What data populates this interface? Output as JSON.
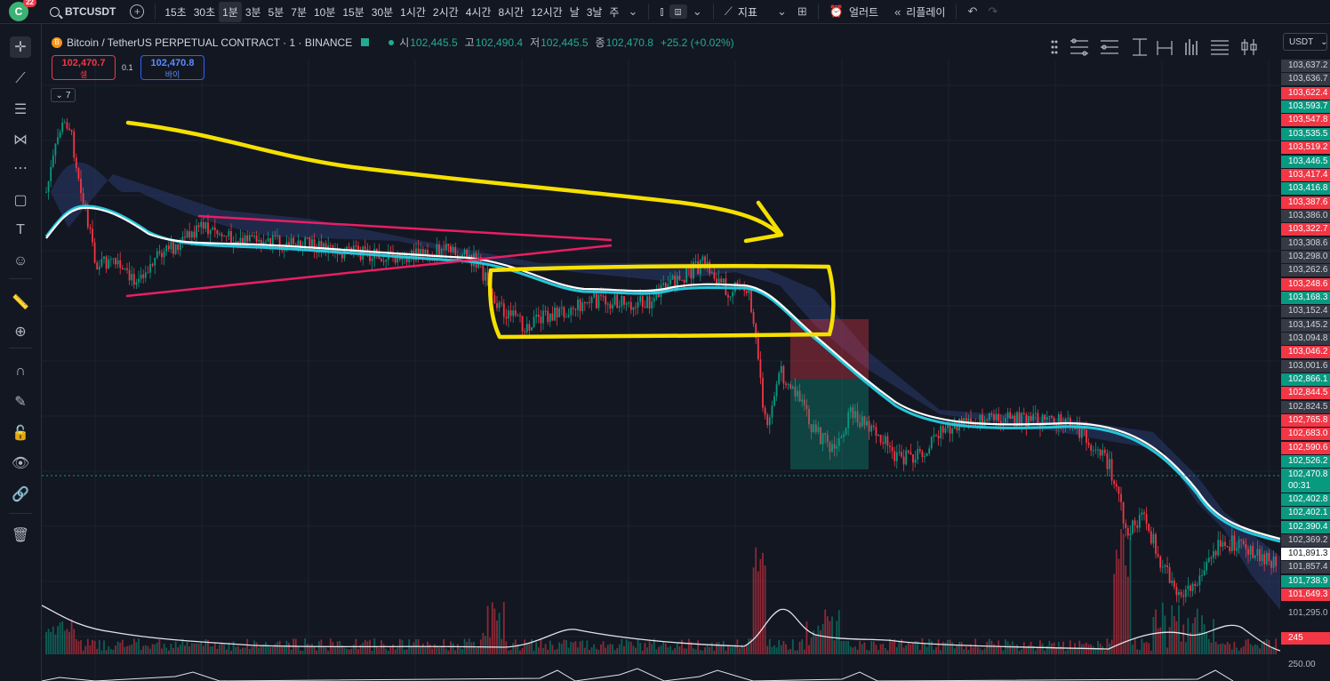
{
  "topbar": {
    "avatar_letter": "C",
    "notification_count": "22",
    "symbol": "BTCUSDT",
    "intervals": [
      "15초",
      "30초",
      "1분",
      "3분",
      "5분",
      "7분",
      "10분",
      "15분",
      "30분",
      "1시간",
      "2시간",
      "4시간",
      "8시간",
      "12시간",
      "날",
      "3날",
      "주"
    ],
    "active_interval": "1분",
    "indicators_label": "지표",
    "alert_label": "얼러트",
    "replay_label": "리플레이"
  },
  "legend": {
    "coin_glyph": "B",
    "title": "Bitcoin / TetherUS PERPETUAL CONTRACT · 1 · BINANCE",
    "open_label": "시",
    "open": "102,445.5",
    "high_label": "고",
    "high": "102,490.4",
    "low_label": "저",
    "low": "102,445.5",
    "close_label": "종",
    "close": "102,470.8",
    "change": "+25.2 (+0.02%)"
  },
  "trade": {
    "sell_price": "102,470.7",
    "sell_label": "셀",
    "spread": "0.1",
    "buy_price": "102,470.8",
    "buy_label": "바이",
    "collapse_label": "7"
  },
  "currency": "USDT",
  "price_labels": [
    {
      "text": "103,637.2",
      "kind": "gray"
    },
    {
      "text": "103,636.7",
      "kind": "gray"
    },
    {
      "text": "103,622.4",
      "kind": "red"
    },
    {
      "text": "103,593.7",
      "kind": "green"
    },
    {
      "text": "103,547.8",
      "kind": "red"
    },
    {
      "text": "103,535.5",
      "kind": "green"
    },
    {
      "text": "103,519.2",
      "kind": "red"
    },
    {
      "text": "103,446.5",
      "kind": "green"
    },
    {
      "text": "103,417.4",
      "kind": "red"
    },
    {
      "text": "103,416.8",
      "kind": "green"
    },
    {
      "text": "103,387.6",
      "kind": "red"
    },
    {
      "text": "103,386.0",
      "kind": "gray"
    },
    {
      "text": "103,322.7",
      "kind": "red"
    },
    {
      "text": "103,308.6",
      "kind": "gray"
    },
    {
      "text": "103,298.0",
      "kind": "gray"
    },
    {
      "text": "103,262.6",
      "kind": "gray"
    },
    {
      "text": "103,248.6",
      "kind": "red"
    },
    {
      "text": "103,168.3",
      "kind": "green"
    },
    {
      "text": "103,152.4",
      "kind": "gray"
    },
    {
      "text": "103,145.2",
      "kind": "gray"
    },
    {
      "text": "103,094.8",
      "kind": "gray"
    },
    {
      "text": "103,046.2",
      "kind": "red"
    },
    {
      "text": "103,001.6",
      "kind": "gray"
    },
    {
      "text": "102,866.1",
      "kind": "green"
    },
    {
      "text": "102,844.5",
      "kind": "red"
    },
    {
      "text": "102,824.5",
      "kind": "gray"
    },
    {
      "text": "102,765.8",
      "kind": "red"
    },
    {
      "text": "102,683.0",
      "kind": "red"
    },
    {
      "text": "102,590.6",
      "kind": "red"
    },
    {
      "text": "102,526.2",
      "kind": "green"
    },
    {
      "text": "102,470.8",
      "kind": "green"
    },
    {
      "text": "00:31",
      "kind": "green"
    },
    {
      "text": "102,402.8",
      "kind": "green"
    },
    {
      "text": "102,402.1",
      "kind": "green"
    },
    {
      "text": "102,390.4",
      "kind": "green"
    },
    {
      "text": "102,369.2",
      "kind": "gray"
    },
    {
      "text": "101,891.3",
      "kind": "white"
    },
    {
      "text": "101,857.4",
      "kind": "gray"
    },
    {
      "text": "101,738.9",
      "kind": "green"
    },
    {
      "text": "101,649.3",
      "kind": "red"
    },
    {
      "text": "101,295.0",
      "kind": "plain"
    },
    {
      "text": "245",
      "kind": "red"
    },
    {
      "text": "250.00",
      "kind": "plain"
    }
  ],
  "colors": {
    "up": "#089981",
    "down": "#f23645",
    "annotation_yellow": "#f5e000",
    "annotation_pink": "#e91e63",
    "ema_white": "#ffffff",
    "ema_cyan": "#26c6da"
  }
}
